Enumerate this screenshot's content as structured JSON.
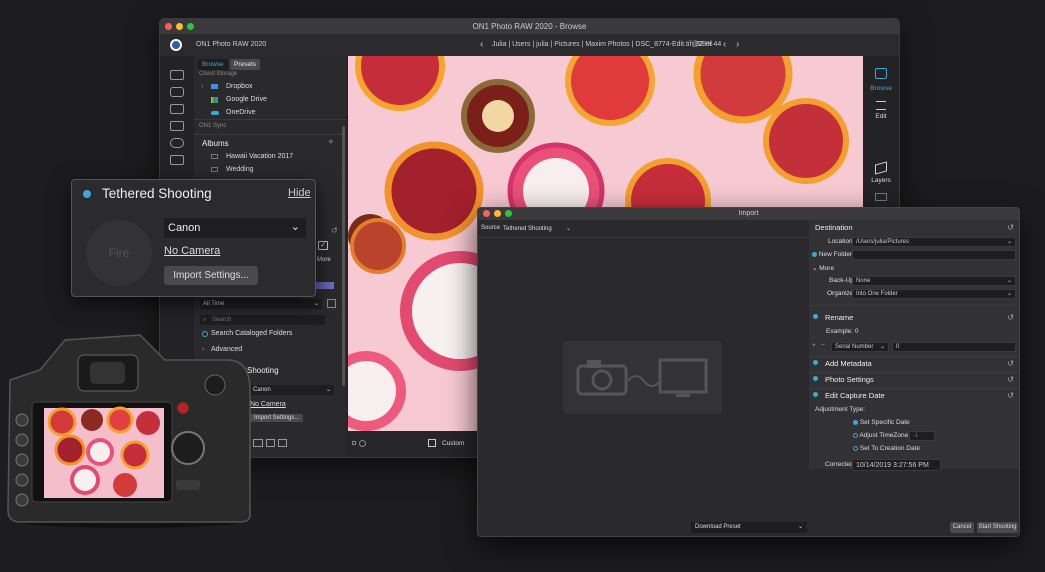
{
  "main_window": {
    "title": "ON1 Photo RAW 2020 - Browse",
    "app_name": "ON1 Photo RAW 2020",
    "breadcrumb": [
      "Julia",
      "Users",
      "julia",
      "Pictures",
      "Maxim Photos",
      "DSC_8774-Edit.tif@29%"
    ],
    "image_count": "32 of 44",
    "tabs": {
      "browse": "Browse",
      "presets": "Presets"
    },
    "panel": {
      "cloud_storage": "Cloud Storage",
      "cloud_items": [
        "Dropbox",
        "Google Drive",
        "OneDrive"
      ],
      "sync": "ON1 Sync",
      "albums_title": "Albums",
      "albums": [
        "Hawaii Vacation 2017",
        "Wedding"
      ],
      "more_label": "More",
      "date_filter": "All Time",
      "search_placeholder": "Search",
      "search_cataloged": "Search Cataloged Folders",
      "advanced": "Advanced",
      "shooting_title": "Shooting",
      "camera_brand": "Canon",
      "no_camera": "No Camera",
      "import_settings": "Import Settings..."
    },
    "right_rail": {
      "browse": "Browse",
      "edit": "Edit",
      "layers": "Layers"
    },
    "bottom": {
      "custom": "Custom"
    }
  },
  "tethered_popup": {
    "title": "Tethered Shooting",
    "hide": "Hide",
    "fire": "Fire",
    "camera_brand": "Canon",
    "no_camera": "No Camera",
    "import_settings": "Import Settings..."
  },
  "import_window": {
    "title": "Import",
    "source_label": "Source",
    "source_value": "Tethered Shooting",
    "destination": {
      "title": "Destination",
      "location_label": "Location",
      "location_value": "/Users/julia/Pictures",
      "new_folder": "New Folder",
      "more": "More",
      "backup_label": "Back-Up:",
      "backup_value": "None",
      "organize_label": "Organize:",
      "organize_value": "Into One Folder"
    },
    "rename": {
      "title": "Rename",
      "example": "Example: 0",
      "serial": "Serial Number",
      "start": "0"
    },
    "add_metadata": "Add Metadata",
    "photo_settings": "Photo Settings",
    "edit_capture_date": {
      "title": "Edit Capture Date",
      "adjustment_type": "Adjustment Type:",
      "options": [
        "Set Specific Date",
        "Adjust TimeZone",
        "Set To Creation Date"
      ],
      "timezone_value": "-1",
      "corrected_label": "Corrected:",
      "corrected_value": "10/14/2019 3:27:56 PM"
    },
    "download_preset": "Download Preset",
    "cancel": "Cancel",
    "start_shooting": "Start Shooting"
  },
  "colors": {
    "accent": "#3fa7d6",
    "window_bg": "#2a2a2c",
    "photo_bg": "#f7c9d3"
  }
}
